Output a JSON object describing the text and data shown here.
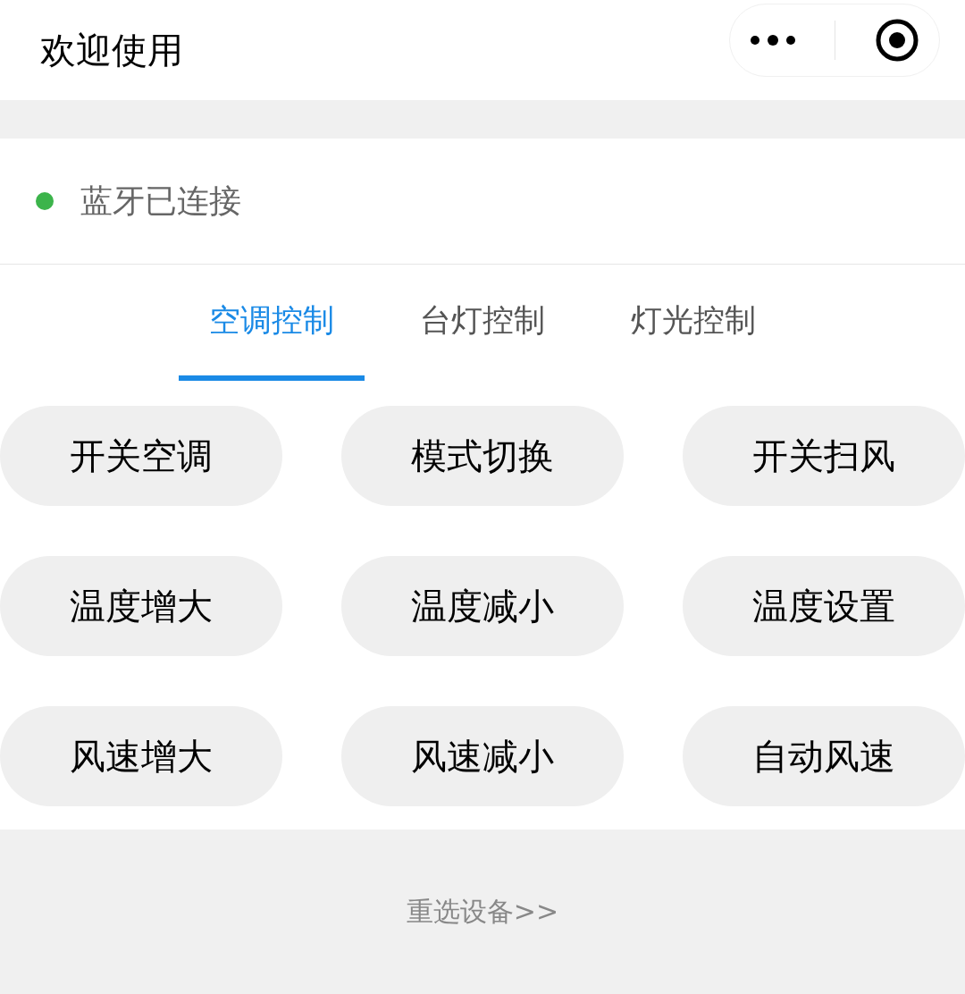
{
  "header": {
    "title": "欢迎使用"
  },
  "status": {
    "text": "蓝牙已连接",
    "color": "#3cb44b"
  },
  "tabs": [
    {
      "label": "空调控制",
      "selected": true
    },
    {
      "label": "台灯控制",
      "selected": false
    },
    {
      "label": "灯光控制",
      "selected": false
    }
  ],
  "buttons": [
    "开关空调",
    "模式切换",
    "开关扫风",
    "温度增大",
    "温度减小",
    "温度设置",
    "风速增大",
    "风速减小",
    "自动风速"
  ],
  "footer": {
    "link": "重选设备>>"
  }
}
